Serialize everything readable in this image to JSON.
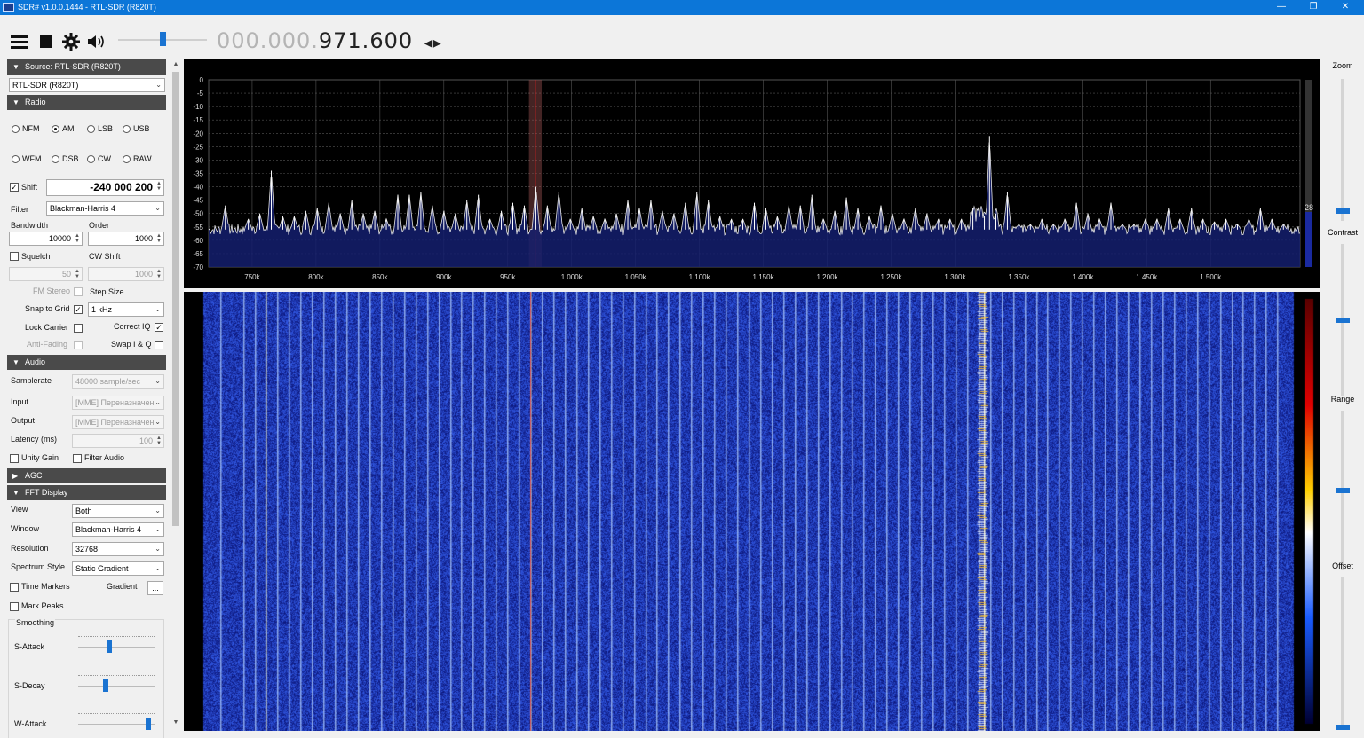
{
  "window": {
    "title": "SDR# v1.0.0.1444 - RTL-SDR (R820T)",
    "controls": {
      "minimize": "—",
      "maximize": "❐",
      "close": "✕"
    }
  },
  "toolbar": {
    "icons": [
      "menu-icon",
      "stop-icon",
      "gear-icon",
      "speaker-icon"
    ],
    "frequency_dim": "000.000.",
    "frequency_main": "971.600",
    "tuning_arrows": "◂▸",
    "volume_fraction": 0.5
  },
  "source": {
    "header": "Source: RTL-SDR (R820T)",
    "device": "RTL-SDR (R820T)"
  },
  "radio": {
    "header": "Radio",
    "modes": [
      {
        "label": "NFM",
        "checked": false
      },
      {
        "label": "AM",
        "checked": true
      },
      {
        "label": "LSB",
        "checked": false
      },
      {
        "label": "USB",
        "checked": false
      },
      {
        "label": "WFM",
        "checked": false
      },
      {
        "label": "DSB",
        "checked": false
      },
      {
        "label": "CW",
        "checked": false
      },
      {
        "label": "RAW",
        "checked": false
      }
    ],
    "shift_label": "Shift",
    "shift_value": "-240 000 200",
    "filter_label": "Filter",
    "filter_value": "Blackman-Harris 4",
    "bandwidth_label": "Bandwidth",
    "bandwidth_value": "10000",
    "order_label": "Order",
    "order_value": "1000",
    "squelch_label": "Squelch",
    "squelch_value": "50",
    "cwshift_label": "CW Shift",
    "cwshift_value": "1000",
    "fmstereo_label": "FM Stereo",
    "stepsize_label": "Step Size",
    "snap_label": "Snap to Grid",
    "snap_value": "1 kHz",
    "lockcarrier_label": "Lock Carrier",
    "correctiq_label": "Correct IQ",
    "antifading_label": "Anti-Fading",
    "swapiq_label": "Swap I & Q"
  },
  "audio": {
    "header": "Audio",
    "samplerate_label": "Samplerate",
    "samplerate_value": "48000 sample/sec",
    "input_label": "Input",
    "input_value": "[MME] Переназначен",
    "output_label": "Output",
    "output_value": "[MME] Переназначен",
    "latency_label": "Latency (ms)",
    "latency_value": "100",
    "unitygain_label": "Unity Gain",
    "filteraudio_label": "Filter Audio"
  },
  "agc": {
    "header": "AGC"
  },
  "fft": {
    "header": "FFT Display",
    "view_label": "View",
    "view_value": "Both",
    "window_label": "Window",
    "window_value": "Blackman-Harris 4",
    "resolution_label": "Resolution",
    "resolution_value": "32768",
    "style_label": "Spectrum Style",
    "style_value": "Static Gradient",
    "timemarkers_label": "Time Markers",
    "gradient_label": "Gradient",
    "gradient_button": "...",
    "markpeaks_label": "Mark Peaks",
    "smoothing_label": "Smoothing",
    "sattack_label": "S-Attack",
    "sattack_level": 0.4,
    "sdecay_label": "S-Decay",
    "sdecay_level": 0.35,
    "wattack_label": "W-Attack",
    "wattack_level": 0.95
  },
  "right_panel": {
    "zoom_label": "Zoom",
    "zoom_level": 0.05,
    "contrast_label": "Contrast",
    "contrast_level": 0.5,
    "range_label": "Range",
    "range_level": 0.5,
    "offset_label": "Offset",
    "offset_level": 0.0
  },
  "chart_data": {
    "type": "line",
    "xlabel": "",
    "ylabel": "",
    "x_unit": "kHz",
    "xlim": [
      716,
      1570
    ],
    "ylim": [
      -70,
      0
    ],
    "yticks": [
      0,
      -5,
      -10,
      -15,
      -20,
      -25,
      -30,
      -35,
      -40,
      -45,
      -50,
      -55,
      -60,
      -65,
      -70
    ],
    "ytick_labels": [
      "0",
      "-5",
      "-10",
      "-15",
      "-20",
      "-25",
      "-30",
      "-35",
      "-40",
      "-45",
      "-50",
      "-55",
      "-60",
      "-65",
      "-70"
    ],
    "xticks": [
      750,
      800,
      850,
      900,
      950,
      1000,
      1050,
      1100,
      1150,
      1200,
      1250,
      1300,
      1350,
      1400,
      1450,
      1500
    ],
    "xtick_labels": [
      "750k",
      "800k",
      "850k",
      "900k",
      "950k",
      "1 000k",
      "1 050k",
      "1 100k",
      "1 150k",
      "1 200k",
      "1 250k",
      "1 300k",
      "1 350k",
      "1 400k",
      "1 450k",
      "1 500k"
    ],
    "grid": true,
    "noise_floor": -56,
    "tuned_center_khz": 971.6,
    "level_readout": "28",
    "peaks": [
      {
        "x": 729,
        "y": -47
      },
      {
        "x": 747,
        "y": -52
      },
      {
        "x": 756,
        "y": -50
      },
      {
        "x": 765,
        "y": -34
      },
      {
        "x": 774,
        "y": -51
      },
      {
        "x": 783,
        "y": -51
      },
      {
        "x": 792,
        "y": -49
      },
      {
        "x": 801,
        "y": -48
      },
      {
        "x": 810,
        "y": -46
      },
      {
        "x": 819,
        "y": -50
      },
      {
        "x": 828,
        "y": -45
      },
      {
        "x": 837,
        "y": -50
      },
      {
        "x": 846,
        "y": -49
      },
      {
        "x": 855,
        "y": -52
      },
      {
        "x": 864,
        "y": -43
      },
      {
        "x": 873,
        "y": -43
      },
      {
        "x": 882,
        "y": -42
      },
      {
        "x": 891,
        "y": -47
      },
      {
        "x": 900,
        "y": -49
      },
      {
        "x": 909,
        "y": -50
      },
      {
        "x": 918,
        "y": -45
      },
      {
        "x": 927,
        "y": -43
      },
      {
        "x": 936,
        "y": -52
      },
      {
        "x": 945,
        "y": -49
      },
      {
        "x": 954,
        "y": -46
      },
      {
        "x": 963,
        "y": -47
      },
      {
        "x": 972,
        "y": -40
      },
      {
        "x": 981,
        "y": -47
      },
      {
        "x": 990,
        "y": -42
      },
      {
        "x": 999,
        "y": -52
      },
      {
        "x": 1008,
        "y": -48
      },
      {
        "x": 1017,
        "y": -51
      },
      {
        "x": 1026,
        "y": -52
      },
      {
        "x": 1035,
        "y": -50
      },
      {
        "x": 1044,
        "y": -45
      },
      {
        "x": 1053,
        "y": -48
      },
      {
        "x": 1062,
        "y": -45
      },
      {
        "x": 1071,
        "y": -49
      },
      {
        "x": 1080,
        "y": -50
      },
      {
        "x": 1089,
        "y": -46
      },
      {
        "x": 1098,
        "y": -42
      },
      {
        "x": 1107,
        "y": -45
      },
      {
        "x": 1116,
        "y": -51
      },
      {
        "x": 1125,
        "y": -52
      },
      {
        "x": 1134,
        "y": -52
      },
      {
        "x": 1143,
        "y": -46
      },
      {
        "x": 1152,
        "y": -48
      },
      {
        "x": 1161,
        "y": -51
      },
      {
        "x": 1170,
        "y": -47
      },
      {
        "x": 1179,
        "y": -47
      },
      {
        "x": 1188,
        "y": -43
      },
      {
        "x": 1197,
        "y": -52
      },
      {
        "x": 1206,
        "y": -49
      },
      {
        "x": 1215,
        "y": -44
      },
      {
        "x": 1224,
        "y": -48
      },
      {
        "x": 1233,
        "y": -51
      },
      {
        "x": 1242,
        "y": -47
      },
      {
        "x": 1251,
        "y": -50
      },
      {
        "x": 1260,
        "y": -52
      },
      {
        "x": 1269,
        "y": -48
      },
      {
        "x": 1278,
        "y": -50
      },
      {
        "x": 1287,
        "y": -52
      },
      {
        "x": 1296,
        "y": -52
      },
      {
        "x": 1305,
        "y": -52
      },
      {
        "x": 1314,
        "y": -48
      },
      {
        "x": 1323,
        "y": -51
      },
      {
        "x": 1327,
        "y": -21
      },
      {
        "x": 1332,
        "y": -50
      },
      {
        "x": 1341,
        "y": -42
      },
      {
        "x": 1350,
        "y": -54
      },
      {
        "x": 1359,
        "y": -54
      },
      {
        "x": 1368,
        "y": -52
      },
      {
        "x": 1377,
        "y": -54
      },
      {
        "x": 1386,
        "y": -52
      },
      {
        "x": 1395,
        "y": -46
      },
      {
        "x": 1404,
        "y": -50
      },
      {
        "x": 1413,
        "y": -52
      },
      {
        "x": 1422,
        "y": -46
      },
      {
        "x": 1431,
        "y": -54
      },
      {
        "x": 1440,
        "y": -54
      },
      {
        "x": 1449,
        "y": -52
      },
      {
        "x": 1458,
        "y": -52
      },
      {
        "x": 1467,
        "y": -48
      },
      {
        "x": 1476,
        "y": -52
      },
      {
        "x": 1485,
        "y": -48
      },
      {
        "x": 1494,
        "y": -52
      },
      {
        "x": 1503,
        "y": -53
      },
      {
        "x": 1512,
        "y": -52
      },
      {
        "x": 1521,
        "y": -54
      },
      {
        "x": 1530,
        "y": -52
      },
      {
        "x": 1539,
        "y": -48
      },
      {
        "x": 1548,
        "y": -52
      },
      {
        "x": 1557,
        "y": -54
      }
    ]
  }
}
